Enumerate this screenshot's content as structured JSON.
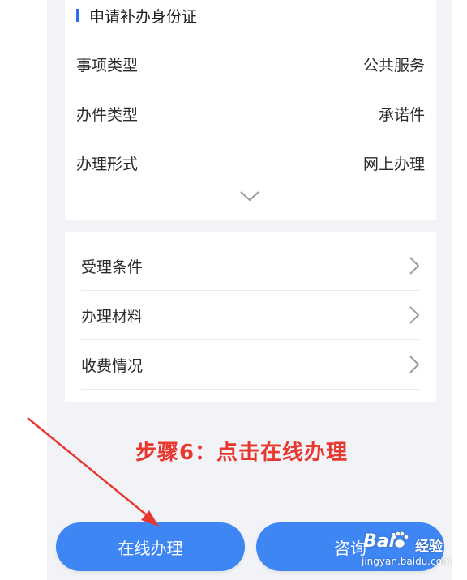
{
  "header": {
    "title": "申请补办身份证"
  },
  "info": {
    "rows": [
      {
        "label": "事项类型",
        "value": "公共服务"
      },
      {
        "label": "办件类型",
        "value": "承诺件"
      },
      {
        "label": "办理形式",
        "value": "网上办理"
      }
    ]
  },
  "links": [
    {
      "label": "受理条件"
    },
    {
      "label": "办理材料"
    },
    {
      "label": "收费情况"
    }
  ],
  "annotation": {
    "caption": "步骤6：点击在线办理",
    "color": "#e8372f"
  },
  "actions": {
    "online_label": "在线办理",
    "consult_label": "咨询"
  },
  "watermark": {
    "brand": "Bai",
    "brand_suffix": "经验",
    "url": "jingyan.baidu.com"
  },
  "colors": {
    "accent": "#2f6bed",
    "button": "#3d86f3",
    "background": "#f2f3f7"
  },
  "icons": {
    "expand": "chevron-down-icon",
    "row_arrow": "chevron-right-icon"
  }
}
